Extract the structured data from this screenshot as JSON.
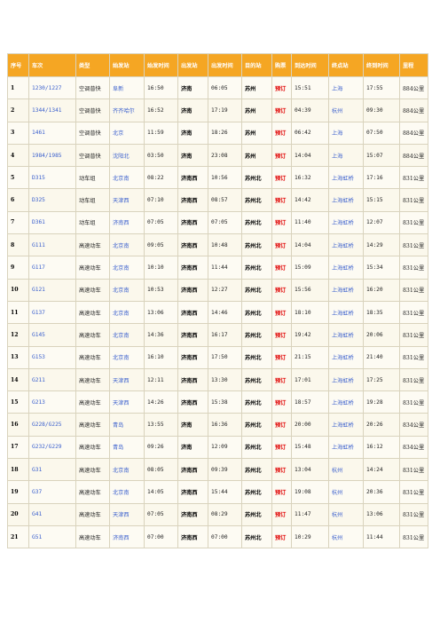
{
  "headers": [
    "序号",
    "车次",
    "类型",
    "始发站",
    "始发时间",
    "出发站",
    "出发时间",
    "目的站",
    "购票",
    "到达时间",
    "终点站",
    "终到时间",
    "里程"
  ],
  "rows": [
    [
      "1",
      "1230/1227",
      "空调普快",
      "阜新",
      "16:50",
      "济南",
      "06:05",
      "苏州",
      "预订",
      "15:51",
      "上海",
      "17:55",
      "884公里"
    ],
    [
      "2",
      "1344/1341",
      "空调普快",
      "齐齐哈尔",
      "16:52",
      "济南",
      "17:19",
      "苏州",
      "预订",
      "04:39",
      "杭州",
      "09:30",
      "884公里"
    ],
    [
      "3",
      "1461",
      "空调普快",
      "北京",
      "11:59",
      "济南",
      "18:26",
      "苏州",
      "预订",
      "06:42",
      "上海",
      "07:50",
      "884公里"
    ],
    [
      "4",
      "1984/1985",
      "空调普快",
      "沈阳北",
      "03:50",
      "济南",
      "23:08",
      "苏州",
      "预订",
      "14:04",
      "上海",
      "15:07",
      "884公里"
    ],
    [
      "5",
      "D315",
      "动车组",
      "北京南",
      "08:22",
      "济南西",
      "10:56",
      "苏州北",
      "预订",
      "16:32",
      "上海虹桥",
      "17:16",
      "831公里"
    ],
    [
      "6",
      "D325",
      "动车组",
      "天津西",
      "07:10",
      "济南西",
      "08:57",
      "苏州北",
      "预订",
      "14:42",
      "上海虹桥",
      "15:15",
      "831公里"
    ],
    [
      "7",
      "D361",
      "动车组",
      "济南西",
      "07:05",
      "济南西",
      "07:05",
      "苏州北",
      "预订",
      "11:40",
      "上海虹桥",
      "12:07",
      "831公里"
    ],
    [
      "8",
      "G111",
      "高速动车",
      "北京南",
      "09:05",
      "济南西",
      "10:48",
      "苏州北",
      "预订",
      "14:04",
      "上海虹桥",
      "14:29",
      "831公里"
    ],
    [
      "9",
      "G117",
      "高速动车",
      "北京南",
      "10:10",
      "济南西",
      "11:44",
      "苏州北",
      "预订",
      "15:09",
      "上海虹桥",
      "15:34",
      "831公里"
    ],
    [
      "10",
      "G121",
      "高速动车",
      "北京南",
      "10:53",
      "济南西",
      "12:27",
      "苏州北",
      "预订",
      "15:56",
      "上海虹桥",
      "16:20",
      "831公里"
    ],
    [
      "11",
      "G137",
      "高速动车",
      "北京南",
      "13:06",
      "济南西",
      "14:46",
      "苏州北",
      "预订",
      "18:10",
      "上海虹桥",
      "18:35",
      "831公里"
    ],
    [
      "12",
      "G145",
      "高速动车",
      "北京南",
      "14:36",
      "济南西",
      "16:17",
      "苏州北",
      "预订",
      "19:42",
      "上海虹桥",
      "20:06",
      "831公里"
    ],
    [
      "13",
      "G153",
      "高速动车",
      "北京南",
      "16:10",
      "济南西",
      "17:50",
      "苏州北",
      "预订",
      "21:15",
      "上海虹桥",
      "21:40",
      "831公里"
    ],
    [
      "14",
      "G211",
      "高速动车",
      "天津西",
      "12:11",
      "济南西",
      "13:30",
      "苏州北",
      "预订",
      "17:01",
      "上海虹桥",
      "17:25",
      "831公里"
    ],
    [
      "15",
      "G213",
      "高速动车",
      "天津西",
      "14:26",
      "济南西",
      "15:38",
      "苏州北",
      "预订",
      "18:57",
      "上海虹桥",
      "19:28",
      "831公里"
    ],
    [
      "16",
      "G228/G225",
      "高速动车",
      "青岛",
      "13:55",
      "济南",
      "16:36",
      "苏州北",
      "预订",
      "20:00",
      "上海虹桥",
      "20:26",
      "834公里"
    ],
    [
      "17",
      "G232/G229",
      "高速动车",
      "青岛",
      "09:26",
      "济南",
      "12:09",
      "苏州北",
      "预订",
      "15:48",
      "上海虹桥",
      "16:12",
      "834公里"
    ],
    [
      "18",
      "G31",
      "高速动车",
      "北京南",
      "08:05",
      "济南西",
      "09:39",
      "苏州北",
      "预订",
      "13:04",
      "杭州",
      "14:24",
      "831公里"
    ],
    [
      "19",
      "G37",
      "高速动车",
      "北京南",
      "14:05",
      "济南西",
      "15:44",
      "苏州北",
      "预订",
      "19:08",
      "杭州",
      "20:36",
      "831公里"
    ],
    [
      "20",
      "G41",
      "高速动车",
      "天津西",
      "07:05",
      "济南西",
      "08:29",
      "苏州北",
      "预订",
      "11:47",
      "杭州",
      "13:06",
      "831公里"
    ],
    [
      "21",
      "G51",
      "高速动车",
      "济南西",
      "07:00",
      "济南西",
      "07:00",
      "苏州北",
      "预订",
      "10:29",
      "杭州",
      "11:44",
      "831公里"
    ]
  ],
  "colors": {
    "header_bg": "#f5a623",
    "link": "#3a5fcd",
    "book": "#e00000"
  }
}
